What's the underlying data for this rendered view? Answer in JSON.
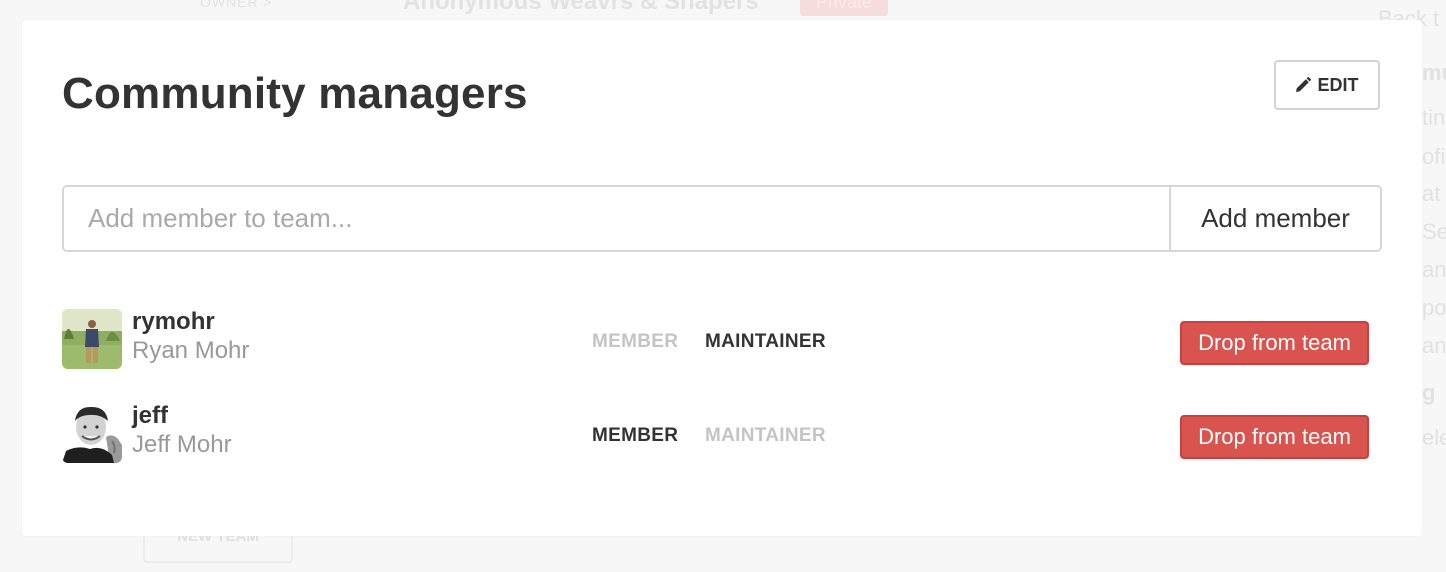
{
  "background": {
    "owner_label": "OWNER >",
    "team_title": "Anonymous Weavrs & Shapers",
    "private_badge": "Private",
    "back_label": "Back t",
    "sidebar_fragments": [
      "mu",
      "tin",
      "ofi",
      "at",
      "Sec",
      "an",
      "po",
      "an",
      "g",
      "ele"
    ],
    "new_team_button": "NEW TEAM"
  },
  "modal": {
    "title": "Community managers",
    "edit_label": "EDIT",
    "add_member_placeholder": "Add member to team...",
    "add_member_button": "Add member"
  },
  "roles": {
    "member": "MEMBER",
    "maintainer": "MAINTAINER"
  },
  "members": [
    {
      "username": "rymohr",
      "full_name": "Ryan Mohr",
      "role": "maintainer",
      "drop_label": "Drop from team"
    },
    {
      "username": "jeff",
      "full_name": "Jeff Mohr",
      "role": "member",
      "drop_label": "Drop from team"
    }
  ],
  "colors": {
    "danger": "#d9534f",
    "text_dark": "#333333",
    "text_muted": "#999999",
    "role_inactive": "#c4c4c4"
  },
  "icons": {
    "edit": "pencil-icon"
  }
}
